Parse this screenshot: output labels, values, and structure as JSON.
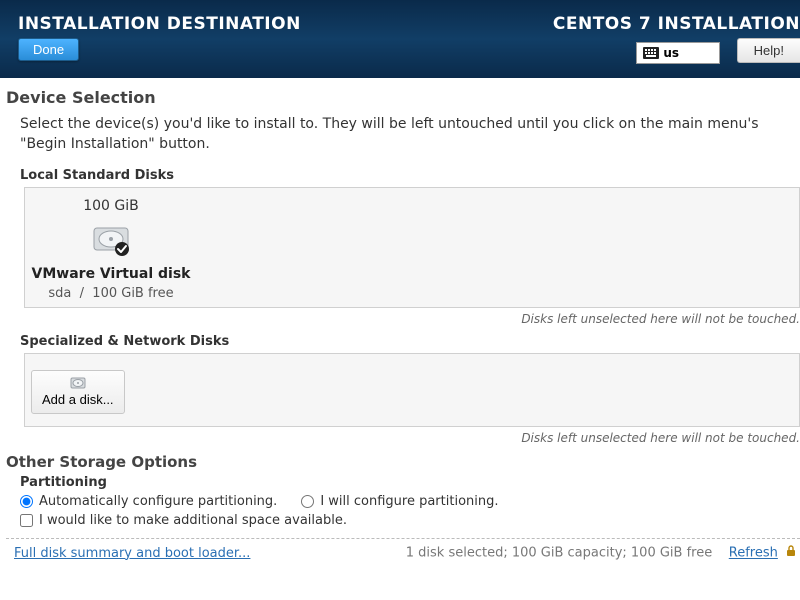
{
  "header": {
    "title": "INSTALLATION DESTINATION",
    "subtitle": "CENTOS 7 INSTALLATION",
    "done": "Done",
    "help": "Help!",
    "keyboard_layout": "us"
  },
  "device_selection": {
    "title": "Device Selection",
    "description": "Select the device(s) you'd like to install to.  They will be left untouched until you click on the main menu's \"Begin Installation\" button."
  },
  "local_disks": {
    "label": "Local Standard Disks",
    "disk": {
      "size": "100 GiB",
      "name": "VMware Virtual disk",
      "device": "sda",
      "free": "100 GiB free"
    },
    "hint": "Disks left unselected here will not be touched."
  },
  "network_disks": {
    "label": "Specialized & Network Disks",
    "add_label": "Add a disk...",
    "hint": "Disks left unselected here will not be touched."
  },
  "other": {
    "title": "Other Storage Options",
    "partitioning_label": "Partitioning",
    "auto": "Automatically configure partitioning.",
    "manual": "I will configure partitioning.",
    "make_space": "I would like to make additional space available."
  },
  "footer": {
    "summary_link": "Full disk summary and boot loader...",
    "status": "1 disk selected; 100 GiB capacity; 100 GiB free",
    "refresh": "Refresh"
  }
}
